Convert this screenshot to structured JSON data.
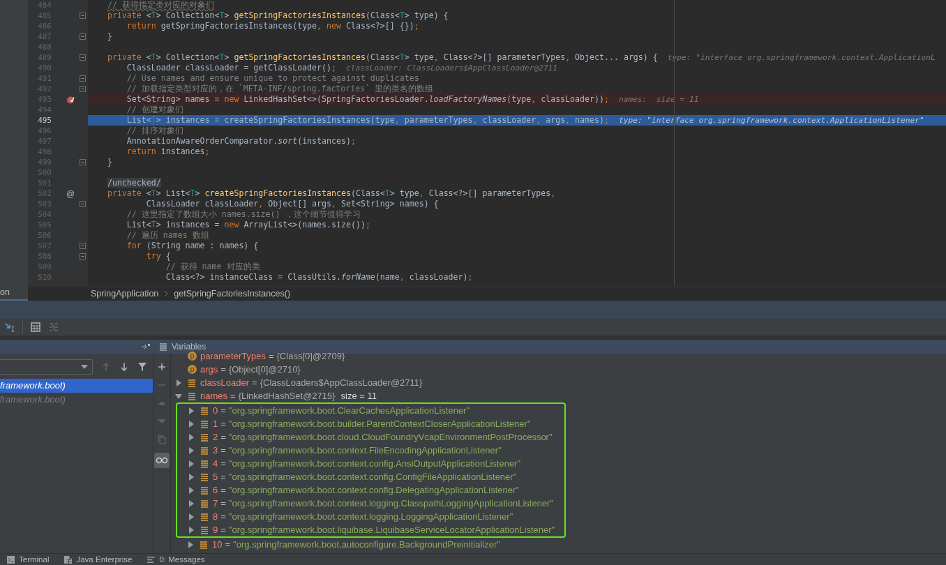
{
  "project_panel": {
    "label": "on"
  },
  "editor": {
    "lines": [
      {
        "number": "484",
        "foldable": false,
        "breakpoint": false,
        "current": false,
        "segments": [
          {
            "kind": "typo",
            "text": "    // 获得指定类对应的对象们"
          }
        ]
      },
      {
        "number": "485",
        "foldable": true,
        "breakpoint": false,
        "current": false,
        "segments": [
          {
            "kind": "kw",
            "text": "    private "
          },
          {
            "kind": "p",
            "text": "<"
          },
          {
            "kind": "tp",
            "text": "T"
          },
          {
            "kind": "p",
            "text": "> Collection<"
          },
          {
            "kind": "tp",
            "text": "T"
          },
          {
            "kind": "p",
            "text": "> "
          },
          {
            "kind": "fn",
            "text": "getSpringFactoriesInstances"
          },
          {
            "kind": "p",
            "text": "(Class<"
          },
          {
            "kind": "tp",
            "text": "T"
          },
          {
            "kind": "p",
            "text": "> type) {"
          }
        ]
      },
      {
        "number": "486",
        "foldable": false,
        "breakpoint": false,
        "current": false,
        "segments": [
          {
            "kind": "kw",
            "text": "        return "
          },
          {
            "kind": "p",
            "text": "getSpringFactoriesInstances(type"
          },
          {
            "kind": "op",
            "text": ", "
          },
          {
            "kind": "kw",
            "text": "new "
          },
          {
            "kind": "p",
            "text": "Class<?>[] {})"
          },
          {
            "kind": "op",
            "text": ";"
          }
        ]
      },
      {
        "number": "487",
        "foldable": true,
        "breakpoint": false,
        "current": false,
        "segments": [
          {
            "kind": "p",
            "text": "    }"
          }
        ]
      },
      {
        "number": "488",
        "foldable": false,
        "breakpoint": false,
        "current": false
      },
      {
        "number": "489",
        "foldable": true,
        "breakpoint": false,
        "current": false,
        "segments": [
          {
            "kind": "kw",
            "text": "    private "
          },
          {
            "kind": "p",
            "text": "<"
          },
          {
            "kind": "tp",
            "text": "T"
          },
          {
            "kind": "p",
            "text": "> Collection<"
          },
          {
            "kind": "tp",
            "text": "T"
          },
          {
            "kind": "p",
            "text": "> "
          },
          {
            "kind": "fn",
            "text": "getSpringFactoriesInstances"
          },
          {
            "kind": "p",
            "text": "(Class<"
          },
          {
            "kind": "tp",
            "text": "T"
          },
          {
            "kind": "p",
            "text": "> type"
          },
          {
            "kind": "op",
            "text": ", "
          },
          {
            "kind": "p",
            "text": "Class<?>[] parameterTypes"
          },
          {
            "kind": "op",
            "text": ", "
          },
          {
            "kind": "p",
            "text": "Object... args) {"
          }
        ],
        "hint": "type: \"interface org.springframework.context.ApplicationL"
      },
      {
        "number": "490",
        "foldable": false,
        "breakpoint": false,
        "current": false,
        "segments": [
          {
            "kind": "p",
            "text": "        ClassLoader classLoader = getClassLoader()"
          },
          {
            "kind": "op",
            "text": ";"
          }
        ],
        "hint": "classLoader: ClassLoaders$AppClassLoader@2711"
      },
      {
        "number": "491",
        "foldable": true,
        "breakpoint": false,
        "current": false,
        "segments": [
          {
            "kind": "cm",
            "text": "        // Use names and ensure unique to protect against duplicates"
          }
        ]
      },
      {
        "number": "492",
        "foldable": true,
        "breakpoint": false,
        "current": false,
        "segments": [
          {
            "kind": "cm",
            "text": "        // 加载指定类型对应的，在 `META-INF/spring.factories` 里的类名的数组"
          }
        ]
      },
      {
        "number": "493",
        "foldable": false,
        "breakpoint": true,
        "current": false,
        "segments": [
          {
            "kind": "p",
            "text": "        Set<String> names = "
          },
          {
            "kind": "kw",
            "text": "new "
          },
          {
            "kind": "p",
            "text": "LinkedHashSet<>(SpringFactoriesLoader."
          },
          {
            "kind": "it",
            "text": "loadFactoryNames"
          },
          {
            "kind": "p",
            "text": "(type"
          },
          {
            "kind": "op",
            "text": ", "
          },
          {
            "kind": "p",
            "text": "classLoader))"
          },
          {
            "kind": "op",
            "text": ";"
          }
        ],
        "hint": "names:  size = 11"
      },
      {
        "number": "494",
        "foldable": false,
        "breakpoint": false,
        "current": false,
        "segments": [
          {
            "kind": "cm",
            "text": "        // 创建对象们"
          }
        ]
      },
      {
        "number": "495",
        "foldable": false,
        "breakpoint": false,
        "current": true,
        "segments": [
          {
            "kind": "p",
            "text": "        List<"
          },
          {
            "kind": "tp",
            "text": "T"
          },
          {
            "kind": "p",
            "text": "> instances = createSpringFactoriesInstances(type"
          },
          {
            "kind": "op",
            "text": ", "
          },
          {
            "kind": "p",
            "text": "parameterTypes"
          },
          {
            "kind": "op",
            "text": ", "
          },
          {
            "kind": "p",
            "text": "classLoader"
          },
          {
            "kind": "op",
            "text": ", "
          },
          {
            "kind": "p",
            "text": "args"
          },
          {
            "kind": "op",
            "text": ", "
          },
          {
            "kind": "p",
            "text": "names)"
          },
          {
            "kind": "op",
            "text": ";"
          }
        ],
        "hint": "type: \"interface org.springframework.context.ApplicationListener\""
      },
      {
        "number": "496",
        "foldable": false,
        "breakpoint": false,
        "current": false,
        "segments": [
          {
            "kind": "cm",
            "text": "        // 排序对象们"
          }
        ]
      },
      {
        "number": "497",
        "foldable": false,
        "breakpoint": false,
        "current": false,
        "segments": [
          {
            "kind": "p",
            "text": "        AnnotationAwareOrderComparator."
          },
          {
            "kind": "it",
            "text": "sort"
          },
          {
            "kind": "p",
            "text": "(instances)"
          },
          {
            "kind": "op",
            "text": ";"
          }
        ]
      },
      {
        "number": "498",
        "foldable": false,
        "breakpoint": false,
        "current": false,
        "segments": [
          {
            "kind": "kw",
            "text": "        return "
          },
          {
            "kind": "p",
            "text": "instances"
          },
          {
            "kind": "op",
            "text": ";"
          }
        ]
      },
      {
        "number": "499",
        "foldable": true,
        "breakpoint": false,
        "current": false,
        "segments": [
          {
            "kind": "p",
            "text": "    }"
          }
        ]
      },
      {
        "number": "500",
        "foldable": false,
        "breakpoint": false,
        "current": false
      },
      {
        "number": "501",
        "foldable": false,
        "breakpoint": false,
        "current": false,
        "segments": [
          {
            "kind": "folded",
            "text": "    /unchecked/"
          }
        ]
      },
      {
        "number": "502",
        "foldable": false,
        "breakpoint": false,
        "current": false,
        "gutter_text": "@",
        "segments": [
          {
            "kind": "kw",
            "text": "    private "
          },
          {
            "kind": "p",
            "text": "<"
          },
          {
            "kind": "tp",
            "text": "T"
          },
          {
            "kind": "p",
            "text": "> List<"
          },
          {
            "kind": "tp",
            "text": "T"
          },
          {
            "kind": "p",
            "text": "> "
          },
          {
            "kind": "fn",
            "text": "createSpringFactoriesInstances"
          },
          {
            "kind": "p",
            "text": "(Class<"
          },
          {
            "kind": "tp",
            "text": "T"
          },
          {
            "kind": "p",
            "text": "> type"
          },
          {
            "kind": "op",
            "text": ", "
          },
          {
            "kind": "p",
            "text": "Class<?>[] parameterTypes"
          },
          {
            "kind": "op",
            "text": ","
          }
        ]
      },
      {
        "number": "503",
        "foldable": true,
        "breakpoint": false,
        "current": false,
        "segments": [
          {
            "kind": "p",
            "text": "            ClassLoader classLoader"
          },
          {
            "kind": "op",
            "text": ", "
          },
          {
            "kind": "p",
            "text": "Object[] args"
          },
          {
            "kind": "op",
            "text": ", "
          },
          {
            "kind": "p",
            "text": "Set<String> names) {"
          }
        ]
      },
      {
        "number": "504",
        "foldable": false,
        "breakpoint": false,
        "current": false,
        "segments": [
          {
            "kind": "cm",
            "text": "        // 这里指定了数组大小 names.size() ，这个细节值得学习"
          }
        ]
      },
      {
        "number": "505",
        "foldable": false,
        "breakpoint": false,
        "current": false,
        "segments": [
          {
            "kind": "p",
            "text": "        List<"
          },
          {
            "kind": "tp",
            "text": "T"
          },
          {
            "kind": "p",
            "text": "> instances = "
          },
          {
            "kind": "kw",
            "text": "new "
          },
          {
            "kind": "p",
            "text": "ArrayList<>(names.size())"
          },
          {
            "kind": "op",
            "text": ";"
          }
        ]
      },
      {
        "number": "506",
        "foldable": false,
        "breakpoint": false,
        "current": false,
        "segments": [
          {
            "kind": "cm",
            "text": "        // 遍历 names 数组"
          }
        ]
      },
      {
        "number": "507",
        "foldable": true,
        "breakpoint": false,
        "current": false,
        "segments": [
          {
            "kind": "kw",
            "text": "        for "
          },
          {
            "kind": "p",
            "text": "(String name : names) {"
          }
        ]
      },
      {
        "number": "508",
        "foldable": true,
        "breakpoint": false,
        "current": false,
        "segments": [
          {
            "kind": "kw",
            "text": "            try "
          },
          {
            "kind": "p",
            "text": "{"
          }
        ]
      },
      {
        "number": "509",
        "foldable": false,
        "breakpoint": false,
        "current": false,
        "segments": [
          {
            "kind": "cm",
            "text": "                // 获得 name 对应的类"
          }
        ]
      },
      {
        "number": "510",
        "foldable": false,
        "breakpoint": false,
        "current": false,
        "segments": [
          {
            "kind": "p",
            "text": "                Class<?> instanceClass = ClassUtils."
          },
          {
            "kind": "it",
            "text": "forName"
          },
          {
            "kind": "p",
            "text": "(name"
          },
          {
            "kind": "op",
            "text": ", "
          },
          {
            "kind": "p",
            "text": "classLoader)"
          },
          {
            "kind": "op",
            "text": ";"
          }
        ]
      }
    ]
  },
  "breadcrumbs": [
    "SpringApplication",
    "getSpringFactoriesInstances()"
  ],
  "frames": {
    "items": [
      {
        "label": "framework.boot)",
        "selected": true
      },
      {
        "label": "framework.boot)",
        "selected": false
      }
    ]
  },
  "variables": {
    "title": "Variables",
    "items": [
      {
        "kind": "param",
        "icon_letter": "p",
        "name": "parameterTypes",
        "operator": "=",
        "value": "{Class[0]@2709}"
      },
      {
        "kind": "param",
        "icon_letter": "p",
        "name": "args",
        "operator": "=",
        "value": "{Object[0]@2710}"
      },
      {
        "kind": "field",
        "name": "classLoader",
        "operator": "=",
        "value": "{ClassLoaders$AppClassLoader@2711}",
        "expanded": false
      },
      {
        "kind": "field",
        "name": "names",
        "operator": "=",
        "value": "{LinkedHashSet@2715}",
        "extra": "size = 11",
        "expanded": true,
        "children": [
          {
            "name": "0",
            "operator": "=",
            "value": "\"org.springframework.boot.ClearCachesApplicationListener\"",
            "expanded": false,
            "annotated": true
          },
          {
            "name": "1",
            "operator": "=",
            "value": "\"org.springframework.boot.builder.ParentContextCloserApplicationListener\"",
            "expanded": false,
            "annotated": true
          },
          {
            "name": "2",
            "operator": "=",
            "value": "\"org.springframework.boot.cloud.CloudFoundryVcapEnvironmentPostProcessor\"",
            "expanded": false,
            "annotated": true
          },
          {
            "name": "3",
            "operator": "=",
            "value": "\"org.springframework.boot.context.FileEncodingApplicationListener\"",
            "expanded": false,
            "annotated": true
          },
          {
            "name": "4",
            "operator": "=",
            "value": "\"org.springframework.boot.context.config.AnsiOutputApplicationListener\"",
            "expanded": false,
            "annotated": true
          },
          {
            "name": "5",
            "operator": "=",
            "value": "\"org.springframework.boot.context.config.ConfigFileApplicationListener\"",
            "expanded": false,
            "annotated": true
          },
          {
            "name": "6",
            "operator": "=",
            "value": "\"org.springframework.boot.context.config.DelegatingApplicationListener\"",
            "expanded": false,
            "annotated": true
          },
          {
            "name": "7",
            "operator": "=",
            "value": "\"org.springframework.boot.context.logging.ClasspathLoggingApplicationListener\"",
            "expanded": false,
            "annotated": true
          },
          {
            "name": "8",
            "operator": "=",
            "value": "\"org.springframework.boot.context.logging.LoggingApplicationListener\"",
            "expanded": false,
            "annotated": true
          },
          {
            "name": "9",
            "operator": "=",
            "value": "\"org.springframework.boot.liquibase.LiquibaseServiceLocatorApplicationListener\"",
            "expanded": false,
            "annotated": true
          },
          {
            "name": "10",
            "operator": "=",
            "value": "\"org.springframework.boot.autoconfigure.BackgroundPreinitializer\"",
            "expanded": false,
            "annotated": false
          }
        ]
      }
    ]
  },
  "status_bar": {
    "tabs": [
      {
        "kind": "terminal",
        "label": "Terminal"
      },
      {
        "kind": "enterprise",
        "label": "Java Enterprise"
      },
      {
        "kind": "messages",
        "label": "0: Messages"
      }
    ]
  }
}
